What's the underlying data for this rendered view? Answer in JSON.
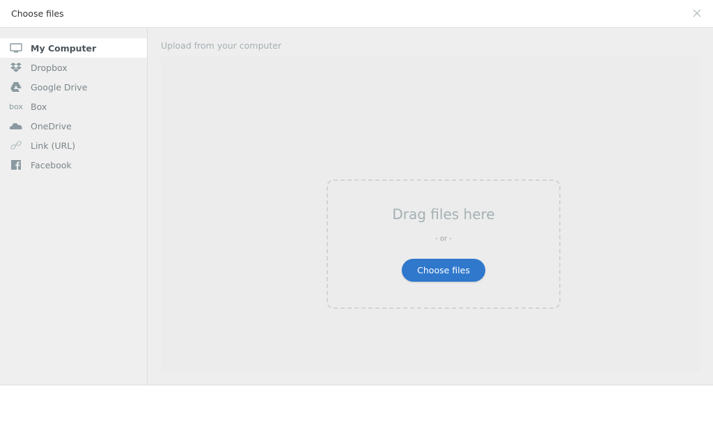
{
  "header": {
    "title": "Choose files",
    "close_icon": "close-icon"
  },
  "sidebar": {
    "items": [
      {
        "label": "My Computer",
        "icon": "monitor-icon",
        "active": true
      },
      {
        "label": "Dropbox",
        "icon": "dropbox-icon",
        "active": false
      },
      {
        "label": "Google Drive",
        "icon": "google-drive-icon",
        "active": false
      },
      {
        "label": "Box",
        "icon": "box-icon",
        "icon_text": "box",
        "active": false
      },
      {
        "label": "OneDrive",
        "icon": "onedrive-icon",
        "active": false
      },
      {
        "label": "Link (URL)",
        "icon": "link-icon",
        "active": false
      },
      {
        "label": "Facebook",
        "icon": "facebook-icon",
        "active": false
      }
    ]
  },
  "main": {
    "subtitle": "Upload from your computer",
    "dropzone": {
      "drag_text": "Drag files here",
      "or_text": "- or -",
      "button_label": "Choose files"
    }
  },
  "colors": {
    "accent": "#2f78cc",
    "icon": "#8a9aa0"
  }
}
